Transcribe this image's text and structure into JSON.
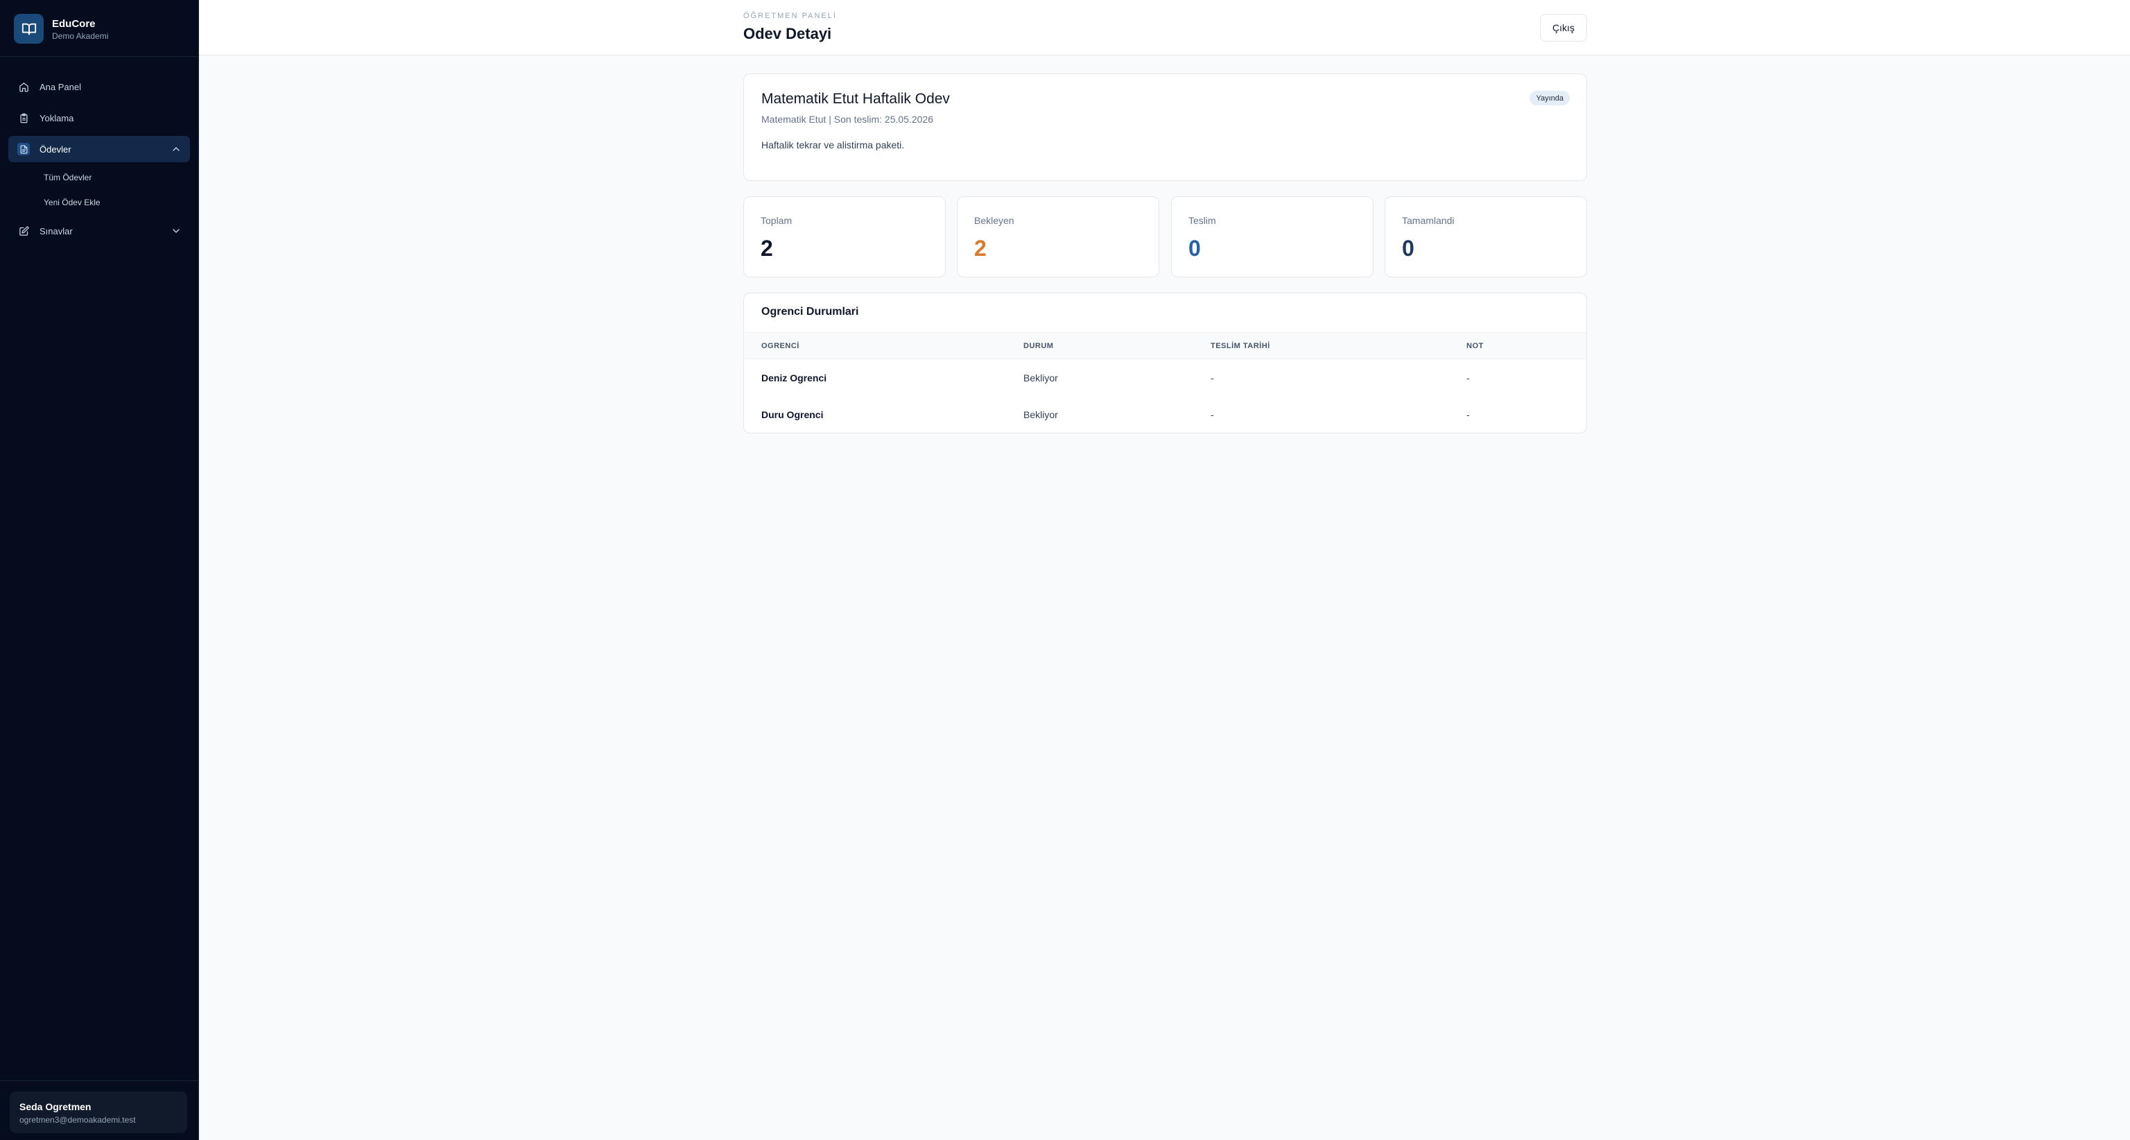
{
  "brand": {
    "name": "EduCore",
    "subtitle": "Demo Akademi"
  },
  "sidebar": {
    "items": [
      {
        "label": "Ana Panel",
        "icon": "home-icon"
      },
      {
        "label": "Yoklama",
        "icon": "clipboard-icon"
      },
      {
        "label": "Ödevler",
        "icon": "document-icon",
        "active": true,
        "expanded": true,
        "children": [
          {
            "label": "Tüm Ödevler"
          },
          {
            "label": "Yeni Ödev Ekle"
          }
        ]
      },
      {
        "label": "Sınavlar",
        "icon": "edit-icon",
        "expanded": false
      }
    ]
  },
  "user": {
    "name": "Seda Ogretmen",
    "email": "ogretmen3@demoakademi.test"
  },
  "header": {
    "eyebrow": "ÖĞRETMEN PANELİ",
    "title": "Odev Detayi",
    "logout_label": "Çıkış"
  },
  "assignment": {
    "title": "Matematik Etut Haftalik Odev",
    "meta": "Matematik Etut | Son teslim: 25.05.2026",
    "description": "Haftalik tekrar ve alistirma paketi.",
    "status": "Yayında"
  },
  "stats": [
    {
      "label": "Toplam",
      "value": "2",
      "color": "#0f172a"
    },
    {
      "label": "Bekleyen",
      "value": "2",
      "color": "#d97a2b"
    },
    {
      "label": "Teslim",
      "value": "0",
      "color": "#2563a8"
    },
    {
      "label": "Tamamlandi",
      "value": "0",
      "color": "#1e3a5f"
    }
  ],
  "students": {
    "title": "Ogrenci Durumlari",
    "columns": [
      "OGRENCİ",
      "DURUM",
      "TESLİM TARİHİ",
      "NOT"
    ],
    "rows": [
      [
        "Deniz Ogrenci",
        "Bekliyor",
        "-",
        "-"
      ],
      [
        "Duru Ogrenci",
        "Bekliyor",
        "-",
        "-"
      ]
    ]
  },
  "colors": {
    "sidebar_bg": "#040c1d",
    "active_bg": "#13294a",
    "accent": "#1a4a7a"
  }
}
